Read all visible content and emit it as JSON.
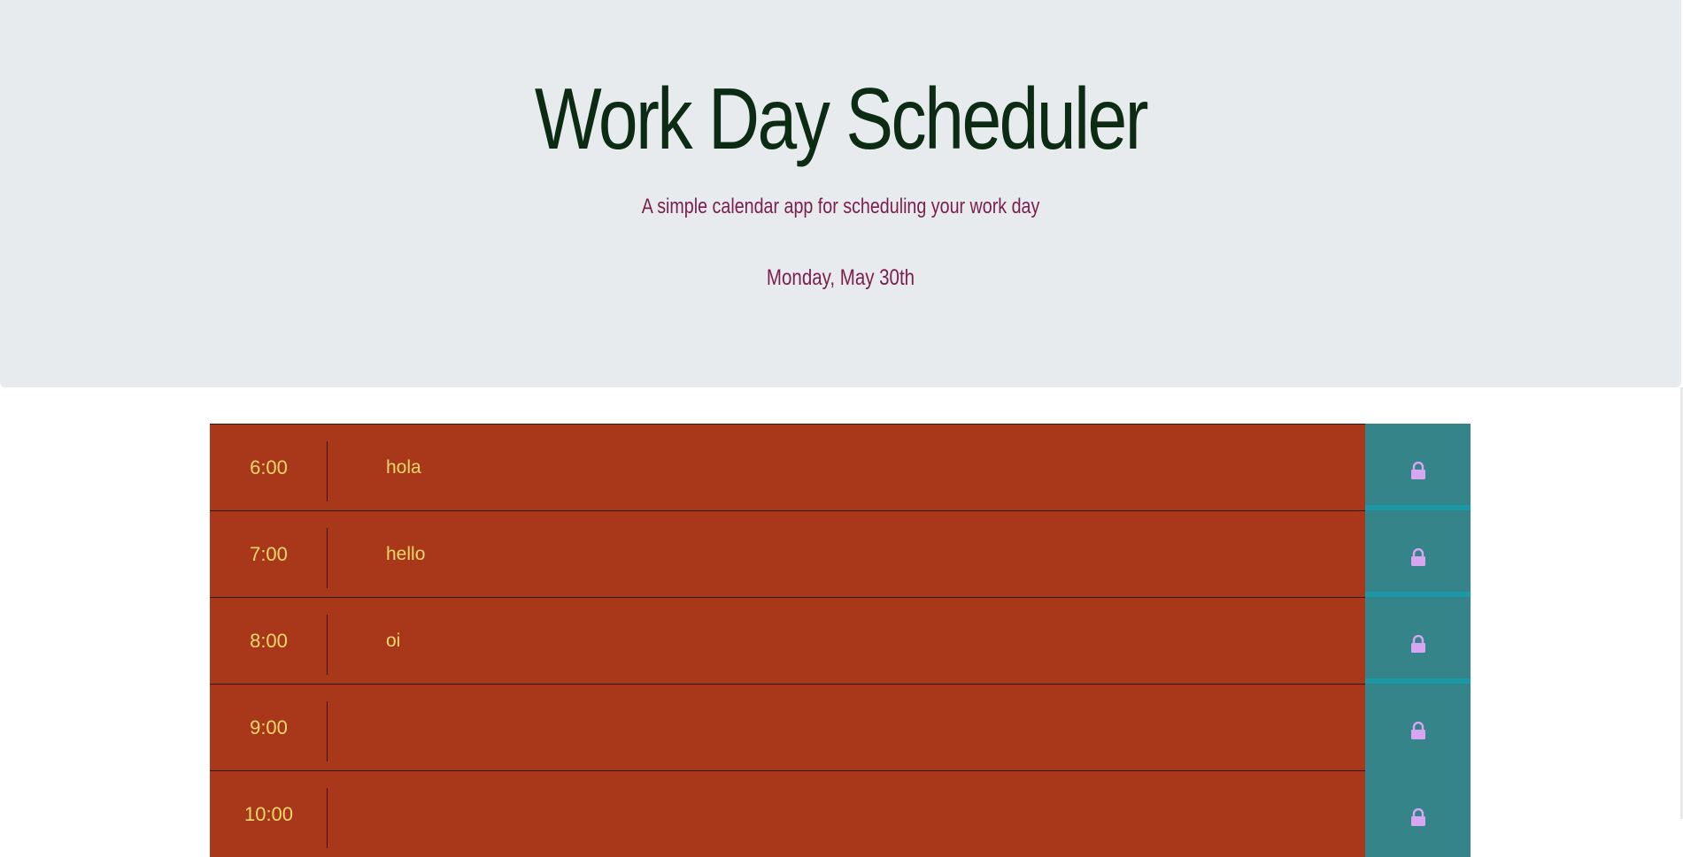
{
  "header": {
    "title": "Work Day Scheduler",
    "lead": "A simple calendar app for scheduling your work day",
    "current_date": "Monday, May 30th"
  },
  "schedule": {
    "rows": [
      {
        "hour": "6:00",
        "text": "hola"
      },
      {
        "hour": "7:00",
        "text": "hello"
      },
      {
        "hour": "8:00",
        "text": "oi"
      },
      {
        "hour": "9:00",
        "text": ""
      },
      {
        "hour": "10:00",
        "text": ""
      }
    ],
    "save_icon": "lock-icon"
  },
  "colors": {
    "header_bg": "#e8ebee",
    "title": "#0b2b12",
    "subtitle": "#7a1f4a",
    "row_past": "#a9381a",
    "hour_text": "#f2d76b",
    "save_bg": "#358489",
    "save_stripe": "#1c97a6",
    "lock_icon": "#d7a6f0"
  }
}
